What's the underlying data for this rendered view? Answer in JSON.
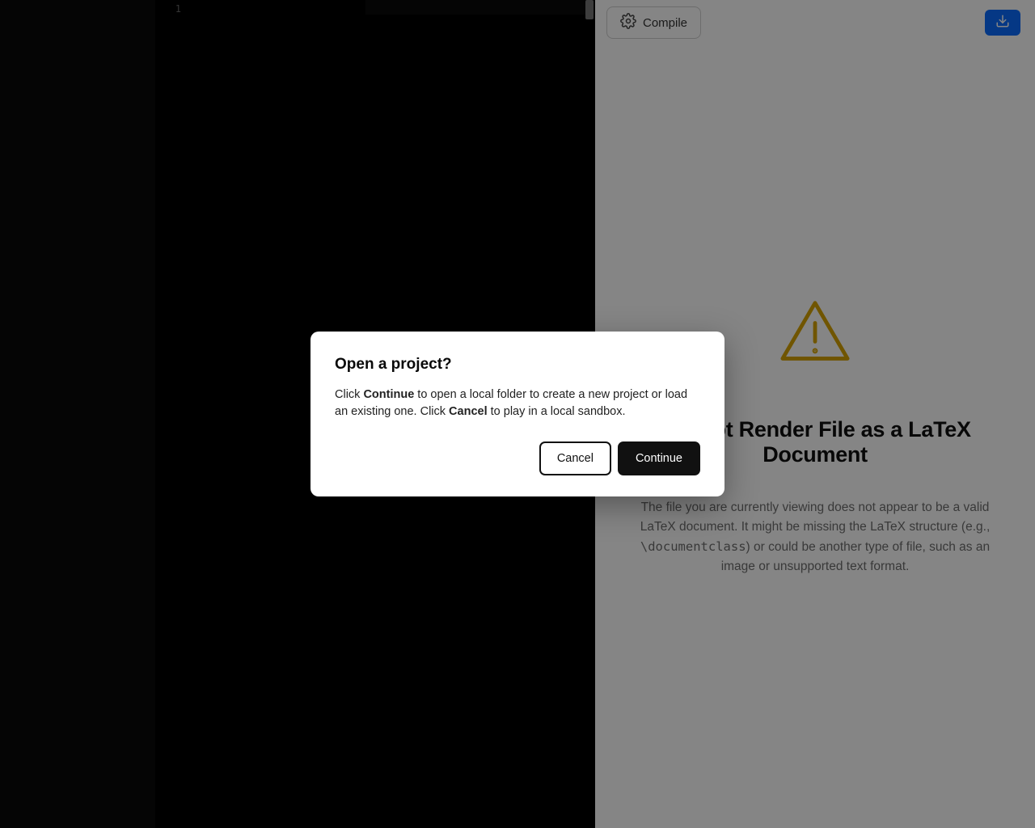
{
  "editor": {
    "line_number": "1"
  },
  "toolbar": {
    "compile_label": "Compile"
  },
  "preview": {
    "warning_title": "Cannot Render File as a LaTeX Document",
    "warning_desc_pre": "The file you are currently viewing does not appear to be a valid LaTeX document. It might be missing the LaTeX structure (e.g., ",
    "warning_desc_code": "\\documentclass",
    "warning_desc_post": ") or could be another type of file, such as an image or unsupported text format."
  },
  "modal": {
    "title": "Open a project?",
    "body_1": "Click ",
    "body_bold_1": "Continue",
    "body_2": " to open a local folder to create a new project or load an existing one. Click ",
    "body_bold_2": "Cancel",
    "body_3": " to play in a local sandbox.",
    "cancel_label": "Cancel",
    "continue_label": "Continue"
  }
}
